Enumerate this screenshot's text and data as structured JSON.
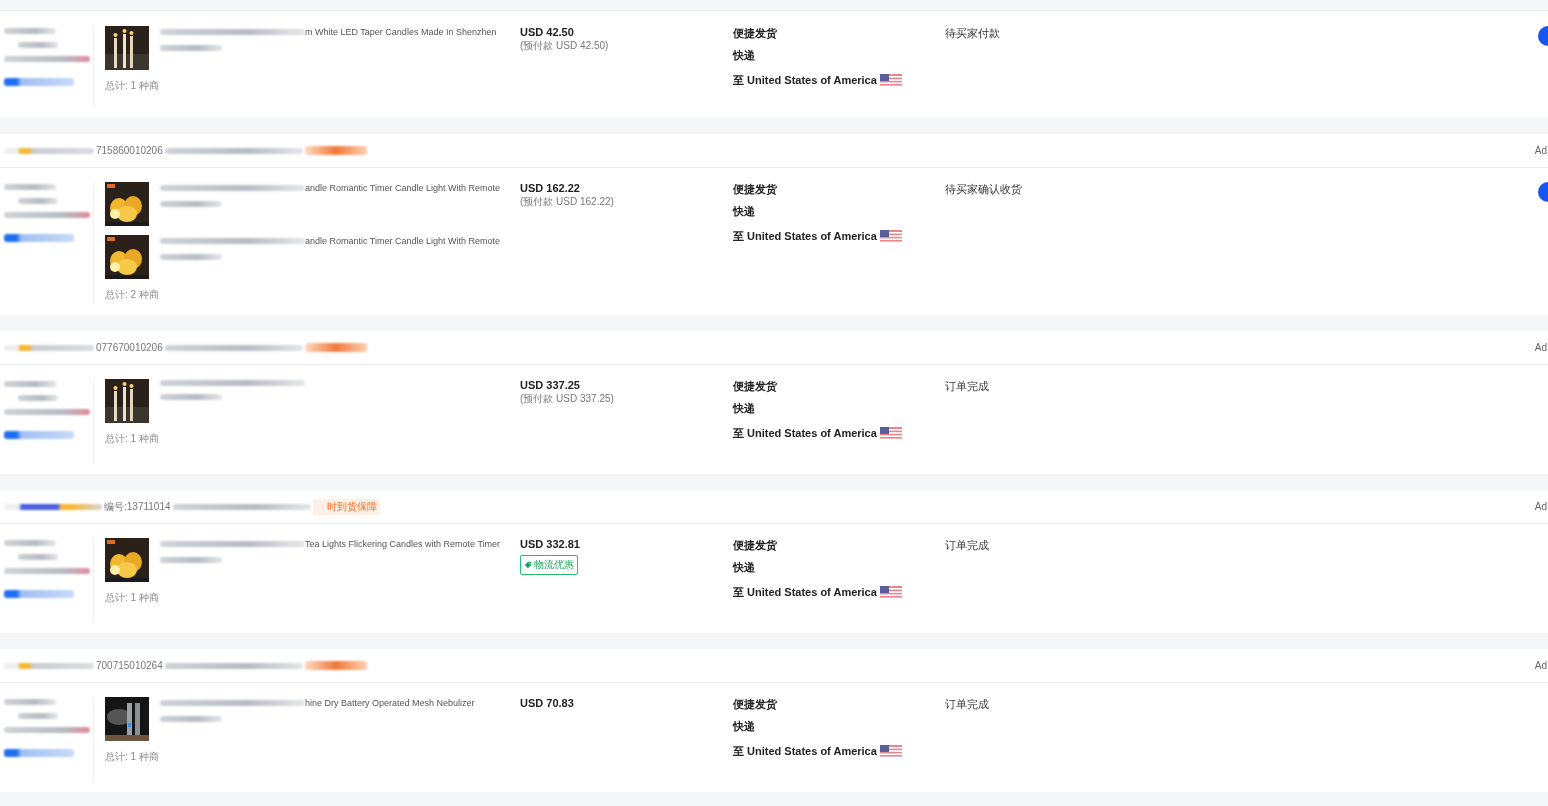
{
  "orders": [
    {
      "products": [
        {
          "title": "m White LED Taper Candles Made In Shenzhen"
        }
      ],
      "total": "总计: 1 种商",
      "price": {
        "amount": "USD 42.50",
        "prepaid": "(预付款 USD 42.50)"
      },
      "shipping": [
        "便捷发货",
        "快递"
      ],
      "destination": "至 United States of America",
      "status": "待买家付款",
      "action_button": true
    },
    {
      "header": {
        "number": "715860010206",
        "right": "Ad"
      },
      "products": [
        {
          "title": "andle Romantic Timer Candle Light With Remote"
        },
        {
          "title": "andle Romantic Timer Candle Light With Remote"
        }
      ],
      "total": "总计: 2 种商",
      "price": {
        "amount": "USD 162.22",
        "prepaid": "(预付款 USD 162.22)"
      },
      "shipping": [
        "便捷发货",
        "快递"
      ],
      "destination": "至 United States of America",
      "status": "待买家确认收货",
      "action_button": true
    },
    {
      "header": {
        "number": "077670010206",
        "right": "Ad"
      },
      "total": "总计: 1 种商",
      "price": {
        "amount": "USD 337.25",
        "prepaid": "(预付款 USD 337.25)"
      },
      "shipping": [
        "便捷发货",
        "快递"
      ],
      "destination": "至 United States of America",
      "status": "订单完成",
      "action_button": false
    },
    {
      "header": {
        "number": "编号:13711014",
        "tag": "时到货保障",
        "right": "Ad"
      },
      "products": [
        {
          "title": "Tea Lights Flickering Candles with Remote Timer"
        }
      ],
      "total": "总计: 1 种商",
      "price": {
        "amount": "USD 332.81",
        "badge": "物流优惠"
      },
      "shipping": [
        "便捷发货",
        "快递"
      ],
      "destination": "至 United States of America",
      "status": "订单完成",
      "action_button": false
    },
    {
      "header": {
        "number": "700715010264",
        "right": "Ad"
      },
      "products": [
        {
          "title": "hine Dry Battery Operated Mesh Nebulizer"
        }
      ],
      "total": "总计: 1 种商",
      "price": {
        "amount": "USD 70.83"
      },
      "shipping": [
        "便捷发货",
        "快递"
      ],
      "destination": "至 United States of America",
      "status": "订单完成",
      "action_button": false
    }
  ]
}
